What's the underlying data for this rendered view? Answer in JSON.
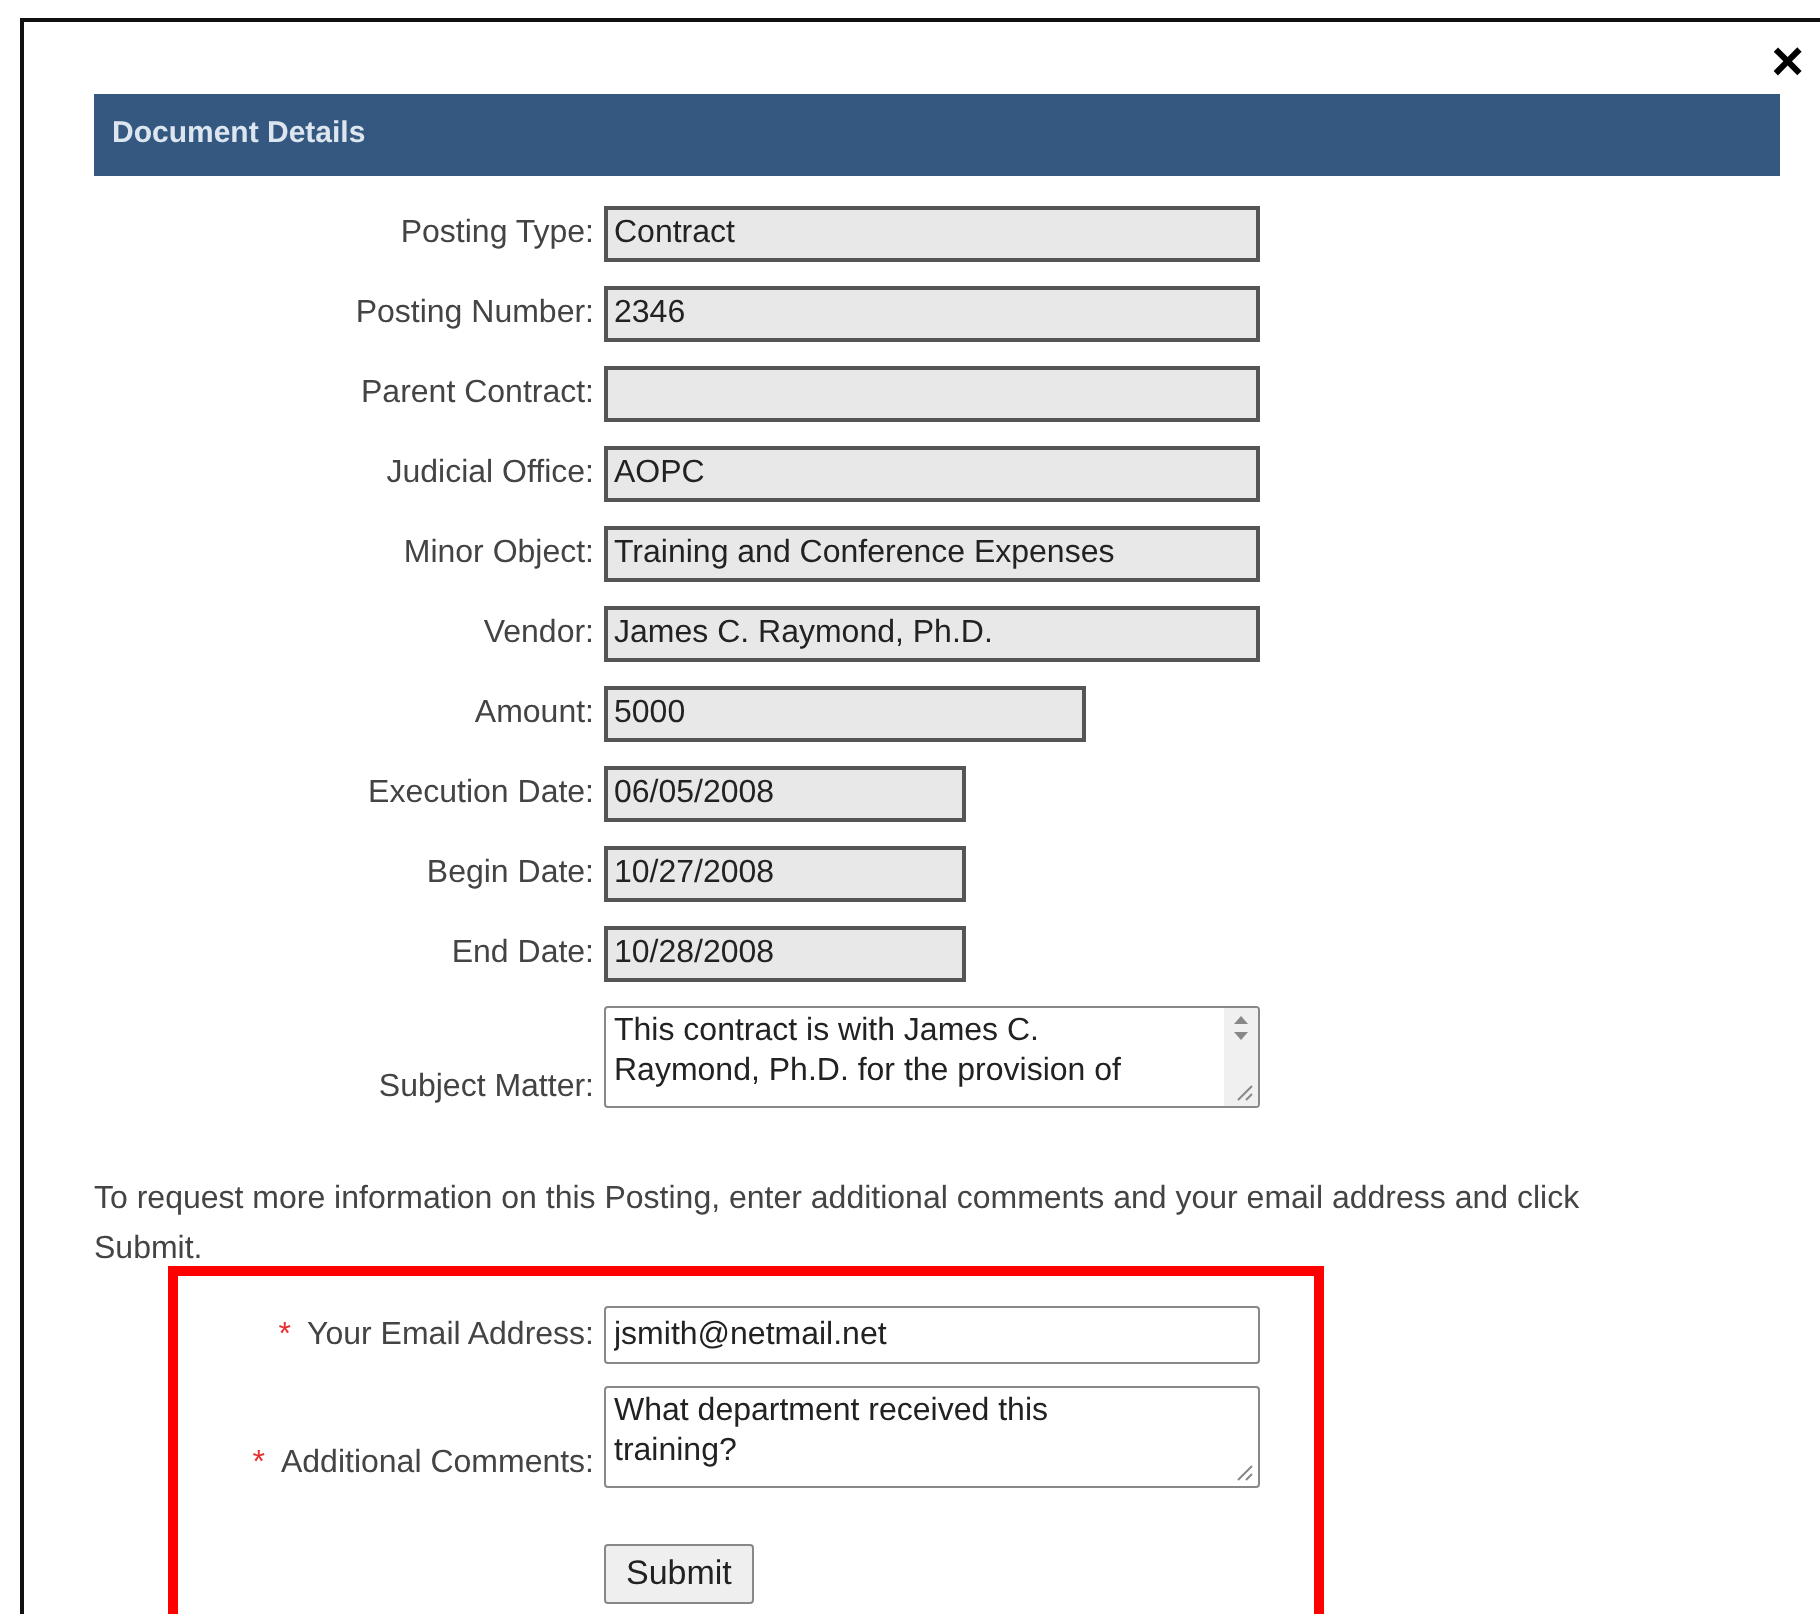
{
  "dialog": {
    "close": "×",
    "title": "Document Details"
  },
  "fields": [
    {
      "label": "Posting Type:",
      "value": "Contract",
      "kind": "long"
    },
    {
      "label": "Posting Number:",
      "value": "2346",
      "kind": "long"
    },
    {
      "label": "Parent Contract:",
      "kind": "long"
    },
    {
      "label": "Judicial Office:",
      "value": "AOPC",
      "kind": "long"
    },
    {
      "label": "Minor Object:",
      "value": "Training and Conference Expenses",
      "kind": "long"
    },
    {
      "label": "Vendor:",
      "value": "James C. Raymond, Ph.D.",
      "kind": "long"
    },
    {
      "label": "Amount:",
      "value": "5000",
      "kind": "medium"
    },
    {
      "label": "Execution Date:",
      "value": "06/05/2008",
      "kind": "short"
    },
    {
      "label": "Begin Date:",
      "value": "10/27/2008",
      "kind": "short"
    },
    {
      "label": "End Date:",
      "value": "10/28/2008",
      "kind": "short"
    }
  ],
  "subject": {
    "label": "Subject Matter:",
    "lines": [
      "This contract is with James C.",
      "Raymond, Ph.D. for the provision of"
    ]
  },
  "request_text": "To request more information on this Posting, enter additional comments and your email address and click Submit.",
  "request_form": {
    "required_mark": "*",
    "email": {
      "label": "Your Email Address:",
      "value": "jsmith@netmail.net"
    },
    "comments": {
      "label": "Additional Comments:",
      "lines": [
        "What department received this",
        "training?"
      ]
    },
    "submit": "Submit"
  }
}
